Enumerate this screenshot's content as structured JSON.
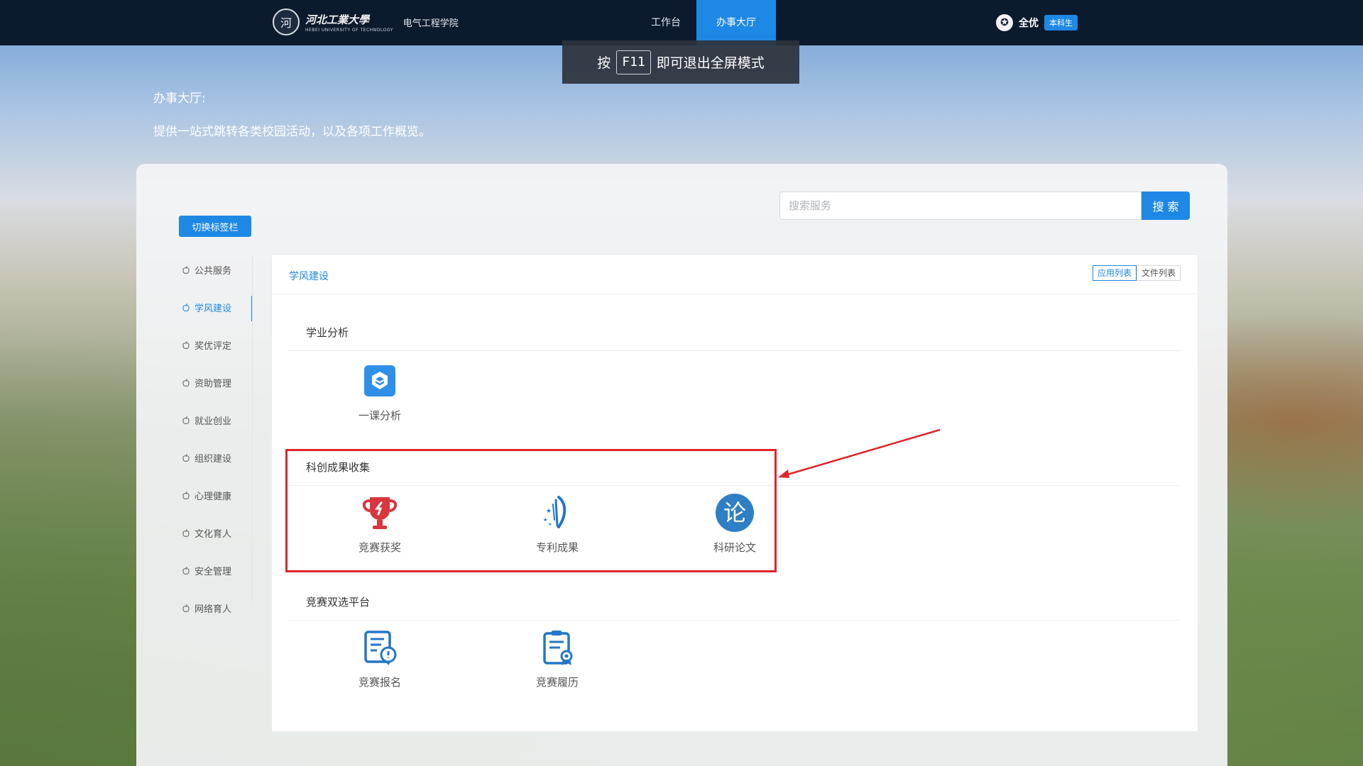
{
  "header": {
    "logo_seal": "河",
    "logo_main": "河北工業大學",
    "logo_sub": "HEBEI UNIVERSITY OF TECHNOLOGY",
    "college": "电气工程学院",
    "nav": [
      {
        "label": "工作台",
        "active": false
      },
      {
        "label": "办事大厅",
        "active": true
      }
    ],
    "user_name": "全优",
    "user_role": "本科生"
  },
  "fullscreen_notice": {
    "prefix": "按",
    "key": "F11",
    "suffix": "即可退出全屏模式"
  },
  "hero": {
    "title": "办事大厅:",
    "description": "提供一站式跳转各类校园活动，以及各项工作概览。"
  },
  "search": {
    "placeholder": "搜索服务",
    "button": "搜 索"
  },
  "toggle_label": "切换标签栏",
  "sidebar": {
    "items": [
      {
        "label": "公共服务",
        "active": false
      },
      {
        "label": "学风建设",
        "active": true
      },
      {
        "label": "奖优评定",
        "active": false
      },
      {
        "label": "资助管理",
        "active": false
      },
      {
        "label": "就业创业",
        "active": false
      },
      {
        "label": "组织建设",
        "active": false
      },
      {
        "label": "心理健康",
        "active": false
      },
      {
        "label": "文化育人",
        "active": false
      },
      {
        "label": "安全管理",
        "active": false
      },
      {
        "label": "网络育人",
        "active": false
      }
    ]
  },
  "card": {
    "title": "学风建设",
    "view_app_list": "应用列表",
    "view_file_list": "文件列表",
    "sections": [
      {
        "title": "学业分析",
        "apps": [
          {
            "label": "一课分析",
            "icon": "course-analysis-icon"
          }
        ]
      },
      {
        "title": "科创成果收集",
        "apps": [
          {
            "label": "竞赛获奖",
            "icon": "trophy-icon"
          },
          {
            "label": "专利成果",
            "icon": "patent-icon"
          },
          {
            "label": "科研论文",
            "icon": "paper-icon"
          }
        ]
      },
      {
        "title": "竞赛双选平台",
        "apps": [
          {
            "label": "竞赛报名",
            "icon": "registration-icon"
          },
          {
            "label": "竞赛履历",
            "icon": "resume-icon"
          }
        ]
      }
    ]
  },
  "icon_glyphs": {
    "paper": "论"
  },
  "colors": {
    "accent": "#1e88e5",
    "nav_bg": "#0c1a2e",
    "highlight": "#e0242a",
    "trophy": "#d9363e"
  }
}
